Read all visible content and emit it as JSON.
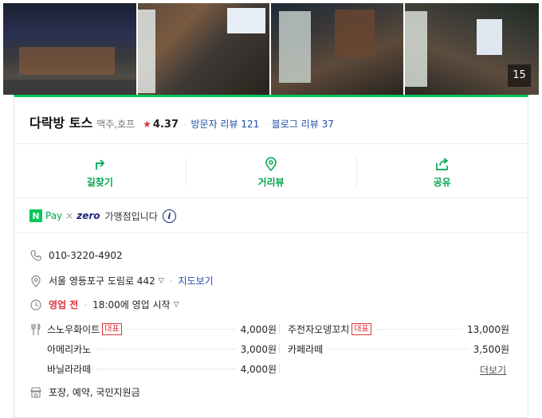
{
  "photos": {
    "items": [
      "storefront-night-photo",
      "interior-photo-1",
      "interior-photo-2",
      "interior-photo-3"
    ],
    "count": "15"
  },
  "place": {
    "name": "다락방 토스",
    "category": "맥주,호프",
    "rating": "4.37",
    "visitor_reviews": "방문자 리뷰 121",
    "blog_reviews": "블로그 리뷰 37"
  },
  "actions": {
    "directions": "길찾기",
    "street_view": "거리뷰",
    "share": "공유"
  },
  "npay": {
    "badge": "N",
    "pay": "Pay",
    "times": "×",
    "zero": "zero",
    "member": "가맹점입니다",
    "info": "i"
  },
  "info": {
    "phone": "010-3220-4902",
    "address": "서울 영등포구 도림로 442",
    "map_link": "지도보기",
    "status": "영업 전",
    "hours": "18:00에 영업 시작",
    "amenities": "포장, 예약, 국민지원금"
  },
  "menu": {
    "items": [
      {
        "name": "스노우화이트",
        "badge": "대표",
        "price": "4,000원"
      },
      {
        "name": "주전자오뎅꼬치",
        "badge": "대표",
        "price": "13,000원"
      },
      {
        "name": "아메리카노",
        "badge": "",
        "price": "3,000원"
      },
      {
        "name": "카페라떼",
        "badge": "",
        "price": "3,500원"
      },
      {
        "name": "바닐라라떼",
        "badge": "",
        "price": "4,000원"
      }
    ],
    "more": "더보기"
  },
  "colors": {
    "accent": "#03c75a",
    "link": "#1f4eaa",
    "alert": "#e0323a"
  }
}
